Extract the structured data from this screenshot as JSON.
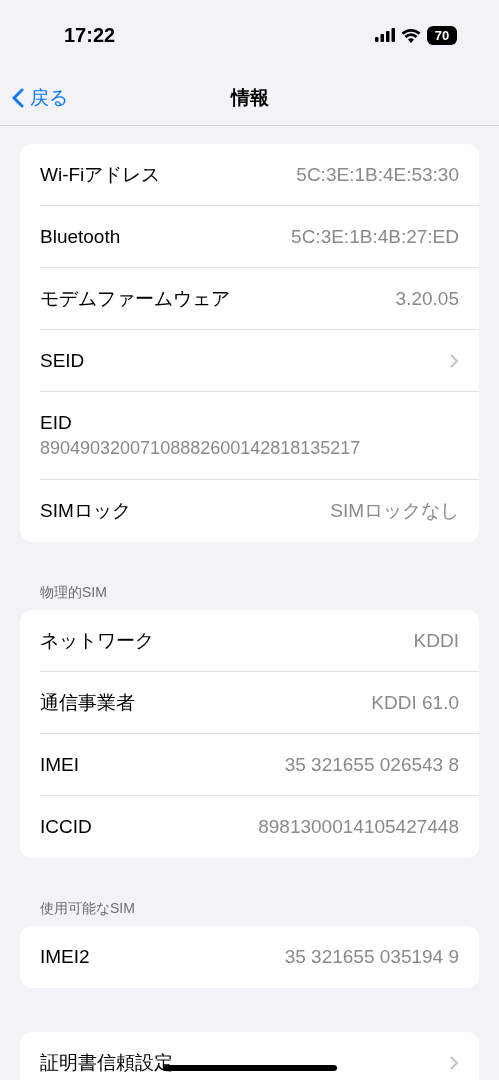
{
  "status_bar": {
    "time": "17:22",
    "battery": "70"
  },
  "nav": {
    "back": "戻る",
    "title": "情報"
  },
  "sections": [
    {
      "rows": [
        {
          "kind": "value",
          "label": "Wi-Fiアドレス",
          "value": "5C:3E:1B:4E:53:30"
        },
        {
          "kind": "value",
          "label": "Bluetooth",
          "value": "5C:3E:1B:4B:27:ED"
        },
        {
          "kind": "value",
          "label": "モデムファームウェア",
          "value": "3.20.05"
        },
        {
          "kind": "chevron",
          "label": "SEID"
        },
        {
          "kind": "stacked",
          "label": "EID",
          "value": "89049032007108882600142818135217"
        },
        {
          "kind": "value",
          "label": "SIMロック",
          "value": "SIMロックなし"
        }
      ]
    },
    {
      "header": "物理的SIM",
      "rows": [
        {
          "kind": "value",
          "label": "ネットワーク",
          "value": "KDDI"
        },
        {
          "kind": "value",
          "label": "通信事業者",
          "value": "KDDI 61.0"
        },
        {
          "kind": "value",
          "label": "IMEI",
          "value": "35 321655 026543 8"
        },
        {
          "kind": "value",
          "label": "ICCID",
          "value": "8981300014105427448"
        }
      ]
    },
    {
      "header": "使用可能なSIM",
      "rows": [
        {
          "kind": "value",
          "label": "IMEI2",
          "value": "35 321655 035194 9"
        }
      ]
    },
    {
      "rows": [
        {
          "kind": "chevron",
          "label": "証明書信頼設定"
        }
      ]
    }
  ]
}
